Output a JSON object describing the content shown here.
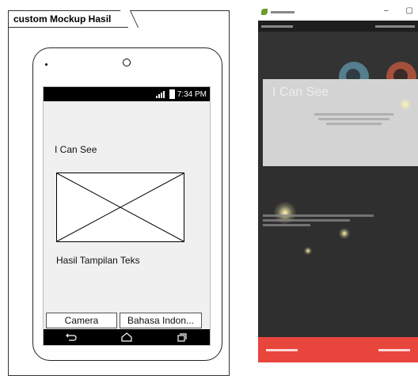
{
  "mockup": {
    "frame_label": "custom Mockup Hasil",
    "status_time": "7:34 PM",
    "title": "I Can See",
    "result_text": "Hasil Tampilan Teks",
    "camera_button": "Camera",
    "language_button": "Bahasa Indon..."
  },
  "screenshot": {
    "top_title": "I Can See",
    "colors": {
      "accent": "#e8453c",
      "background": "#2f2f2f"
    }
  }
}
